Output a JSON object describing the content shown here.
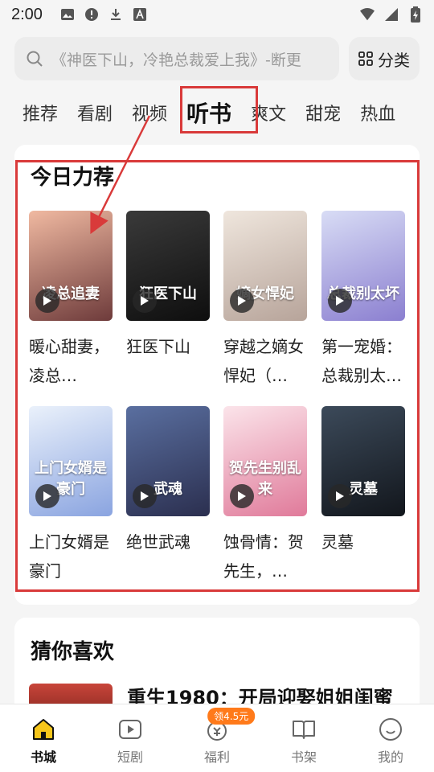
{
  "status_bar": {
    "time": "2:00",
    "icons": [
      "image-icon",
      "alert-icon",
      "download-icon",
      "a-icon",
      "wifi-icon",
      "signal-icon",
      "battery-icon"
    ]
  },
  "search": {
    "placeholder": "《神医下山，冷艳总裁爱上我》-断更",
    "category_label": "分类"
  },
  "tabs": [
    "推荐",
    "看剧",
    "视频",
    "听书",
    "爽文",
    "甜宠",
    "热血"
  ],
  "active_tab": "听书",
  "section": {
    "title": "今日力荐"
  },
  "books": [
    {
      "title": "暖心甜妻，凌总…",
      "cover_text": "凌总追妻",
      "color1": "#f0b9a1",
      "color2": "#6e3b3b"
    },
    {
      "title": "狂医下山",
      "cover_text": "狂医下山",
      "color1": "#3a3a3a",
      "color2": "#0e0e0e"
    },
    {
      "title": "穿越之嫡女悍妃（…",
      "cover_text": "嫡女悍妃",
      "color1": "#efe6dd",
      "color2": "#b7a49a"
    },
    {
      "title": "第一宠婚：总裁别太…",
      "cover_text": "总裁别太坏",
      "color1": "#d8dcf5",
      "color2": "#8b7fd0"
    },
    {
      "title": "上门女婿是豪门",
      "cover_text": "上门女婿是豪门",
      "color1": "#eaf1fb",
      "color2": "#8aa4e0"
    },
    {
      "title": "绝世武魂",
      "cover_text": "武魂",
      "color1": "#5a6fa0",
      "color2": "#2b2f4f"
    },
    {
      "title": "蚀骨情：贺先生，…",
      "cover_text": "贺先生别乱来",
      "color1": "#fbe4ea",
      "color2": "#e07a9a"
    },
    {
      "title": "灵墓",
      "cover_text": "灵墓",
      "color1": "#3c4a5a",
      "color2": "#12161c"
    }
  ],
  "guess": {
    "title": "猜你喜欢",
    "first_book": "重生1980：开局迎娶姐姐闺蜜"
  },
  "bottom_nav": [
    {
      "label": "书城",
      "icon": "home-icon"
    },
    {
      "label": "短剧",
      "icon": "play-video-icon"
    },
    {
      "label": "福利",
      "icon": "gift-icon",
      "badge": "领4.5元"
    },
    {
      "label": "书架",
      "icon": "bookshelf-icon"
    },
    {
      "label": "我的",
      "icon": "profile-icon"
    }
  ],
  "colors": {
    "highlight": "#d93a3a",
    "badge": "#ff7a1a"
  }
}
